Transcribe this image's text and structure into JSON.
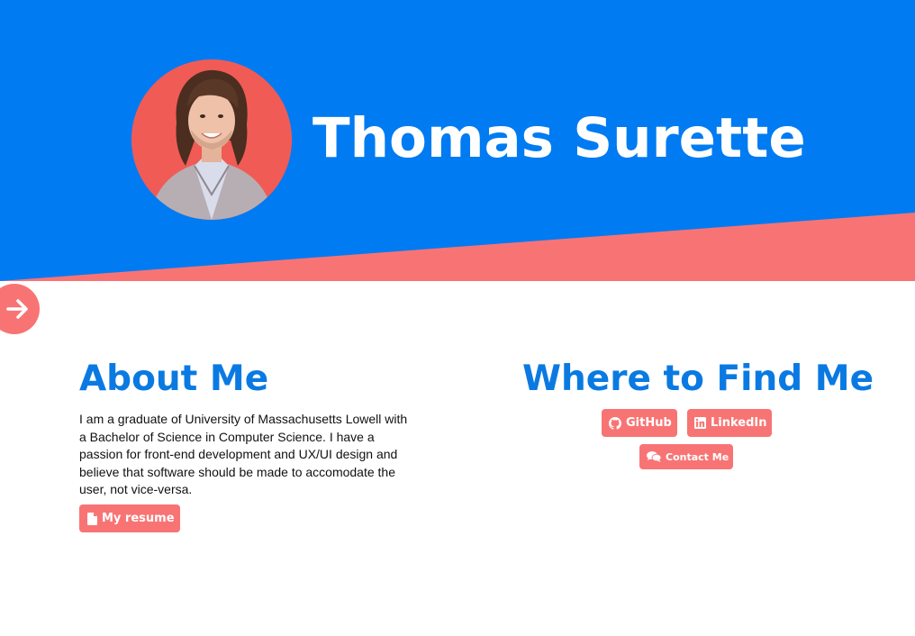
{
  "hero": {
    "name": "Thomas Surette",
    "colors": {
      "header_blue": "#007bf2",
      "accent_coral": "#f87474",
      "avatar_bg": "#f15b55"
    }
  },
  "side_toggle": {
    "icon": "arrow-right-icon"
  },
  "about": {
    "title": "About Me",
    "body": "I am a graduate of University of Massachusetts Lowell with a Bachelor of Science in Computer Science. I have a passion for front-end development and UX/UI design and believe that software should be made to accomodate the user, not vice-versa.",
    "resume_button": {
      "label": "My resume",
      "icon": "file-icon"
    }
  },
  "find": {
    "title": "Where to Find Me",
    "links": {
      "github": {
        "label": "GitHub",
        "icon": "github-icon"
      },
      "linkedin": {
        "label": "LinkedIn",
        "icon": "linkedin-icon"
      },
      "contact": {
        "label": "Contact Me",
        "icon": "chat-icon"
      }
    }
  },
  "colors": {
    "title_blue": "#0a7ae2",
    "text": "#111111",
    "background": "#ffffff"
  }
}
